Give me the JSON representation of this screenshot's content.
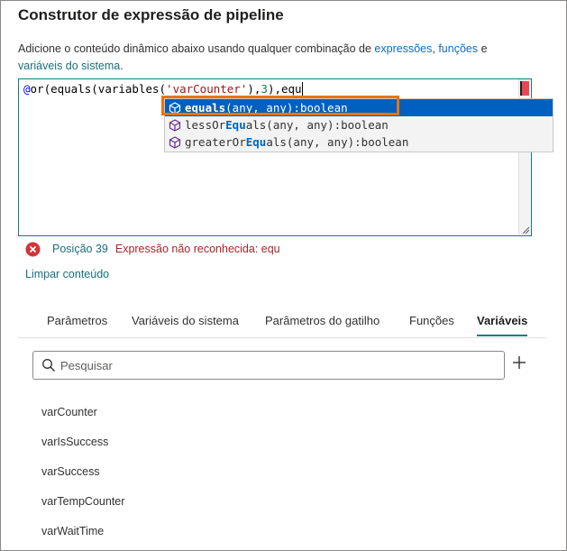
{
  "dialog": {
    "title": "Construtor de expressão de pipeline",
    "description_prefix": "Adicione o conteúdo dinâmico abaixo usando qualquer combinação de ",
    "link_expressions": "expressões",
    "comma": ", ",
    "link_functions": "funções",
    "and": " e",
    "link_system_vars": "variáveis do sistema",
    "period": "."
  },
  "editor": {
    "code": {
      "prefix_at": "@",
      "part1": "or(equals(variables(",
      "string": "'varCounter'",
      "part2": "),",
      "number": "3",
      "part3": "),equ"
    }
  },
  "suggestions": [
    {
      "match": "equals",
      "pre": "",
      "rest": "(any, any):boolean",
      "selected": true
    },
    {
      "pre": "lessOr",
      "match": "Equ",
      "rest": "als(any, any):boolean",
      "selected": false
    },
    {
      "pre": "greaterOr",
      "match": "Equ",
      "rest": "als(any, any):boolean",
      "selected": false
    }
  ],
  "error": {
    "position": "Posição 39",
    "message": "Expressão não reconhecida: equ"
  },
  "clear_label": "Limpar conteúdo",
  "tabs": [
    "Parâmetros",
    "Variáveis do sistema",
    "Parâmetros do gatilho",
    "Funções",
    "Variáveis"
  ],
  "active_tab": "Variáveis",
  "search": {
    "placeholder": "Pesquisar"
  },
  "variables": [
    "varCounter",
    "varIsSuccess",
    "varSuccess",
    "varTempCounter",
    "varWaitTime"
  ],
  "colors": {
    "accent_teal": "#107c82",
    "link_blue": "#0f6cbd",
    "error_red": "#a4262c",
    "highlight_orange": "#e8740c",
    "selection_blue": "#0060c0"
  },
  "icons": {
    "error": "error-circle-icon",
    "search": "search-icon",
    "add": "plus-icon",
    "suggestion": "cube-method-icon"
  }
}
